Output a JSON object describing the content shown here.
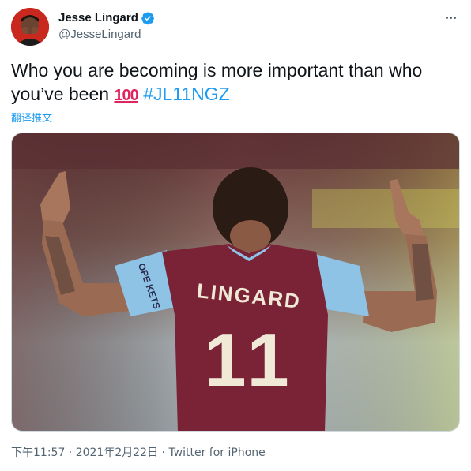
{
  "author": {
    "display_name": "Jesse Lingard",
    "handle": "@JesseLingard",
    "verified": true
  },
  "tweet": {
    "text_main": "Who you are becoming is more important than who you’ve been ",
    "emoji": "100",
    "hashtag": "#JL11NGZ",
    "translate_label": "翻译推文"
  },
  "photo": {
    "shirt_name": "LINGARD",
    "shirt_number": "11",
    "sleeve_sponsor": "OPE KETS"
  },
  "meta": {
    "time": "下午11:57",
    "date": "2021年2月22日",
    "separator": " · ",
    "source": "Twitter for iPhone"
  },
  "colors": {
    "link": "#1d9bf0",
    "text": "#0f1419",
    "muted": "#536471",
    "claret": "#7a2336",
    "sky_blue": "#8ec3e6"
  },
  "icons": {
    "verified": "verified-badge-icon",
    "more": "more-options-icon"
  }
}
